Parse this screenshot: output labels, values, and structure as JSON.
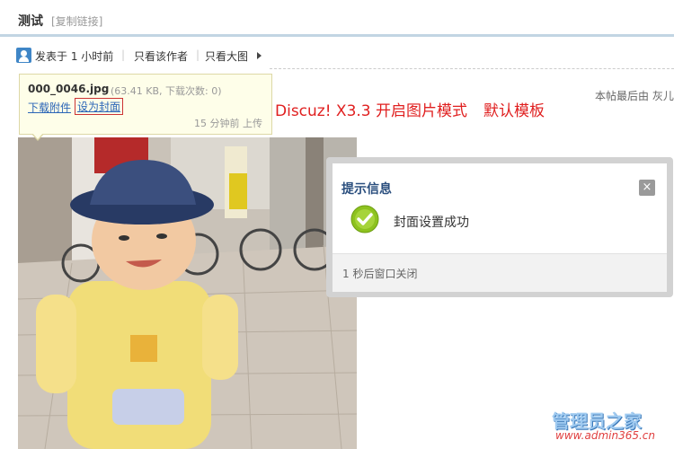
{
  "header": {
    "title": "测试",
    "copy_link": "[复制链接]"
  },
  "post_meta": {
    "posted": "发表于 1 小时前",
    "separator": "|",
    "author_only": "只看该作者",
    "big_image_only": "只看大图",
    "last_edit": "本帖最后由 灰儿"
  },
  "attachment_tip": {
    "filename": "000_0046.jpg",
    "info": "(63.41 KB, 下载次数: 0)",
    "download_link": "下载附件",
    "set_cover_link": "设为封面",
    "upload_time": "15 分钟前 上传"
  },
  "note": {
    "part1": "Discuz! X3.3 开启图片模式",
    "part2": "默认模板"
  },
  "dialog": {
    "title": "提示信息",
    "close_symbol": "×",
    "message": "封面设置成功",
    "footer": "1 秒后窗口关闭"
  },
  "watermark": {
    "title": "管理员之家",
    "url": "www.admin365.cn"
  },
  "colors": {
    "link": "#2b65b7",
    "accent_red": "#e02020",
    "dialog_title": "#2b4f7e",
    "success_green": "#8dc21f"
  }
}
